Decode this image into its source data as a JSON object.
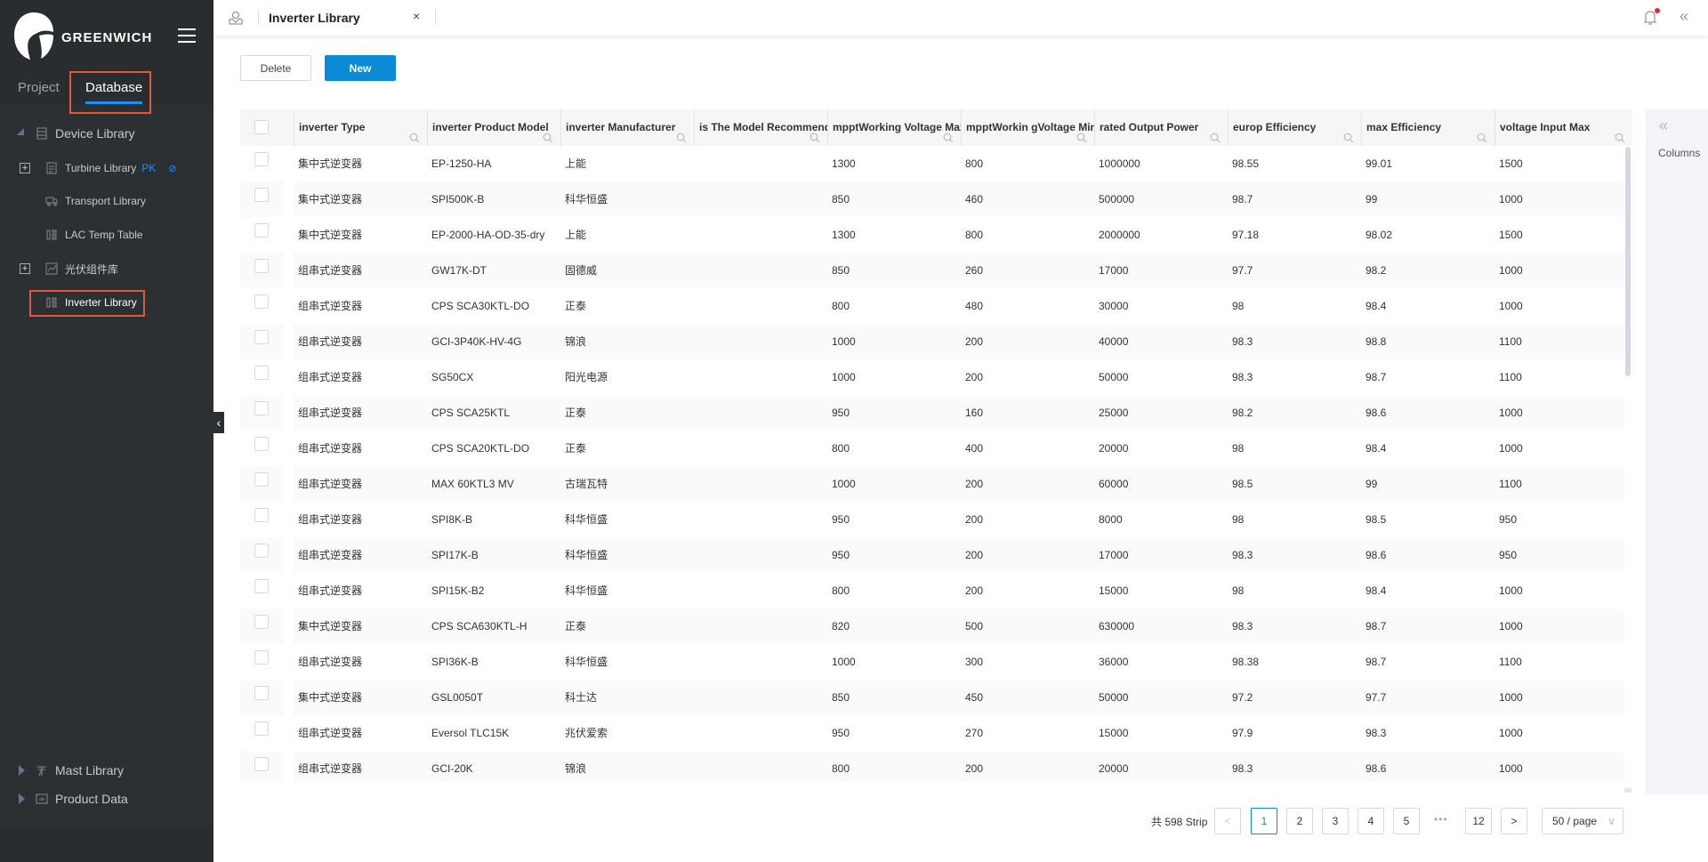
{
  "sidebar": {
    "brand": "GREENWICH",
    "tabs": [
      {
        "label": "Project"
      },
      {
        "label": "Database"
      }
    ],
    "active_tab": "Database",
    "tree": {
      "device_library": "Device Library",
      "turbine_library": "Turbine Library",
      "turbine_badge": "PK",
      "transport_library": "Transport Library",
      "lac_temp_table": "LAC Temp Table",
      "pv_module_library": "光伏组件库",
      "inverter_library": "Inverter Library",
      "mast_library": "Mast Library",
      "product_data": "Product Data"
    }
  },
  "tabbar": {
    "active_tab": "Inverter Library",
    "close": "×"
  },
  "toolbar": {
    "delete_label": "Delete",
    "new_label": "New"
  },
  "table": {
    "columns": [
      "inverter Type",
      "inverter Product Model",
      "inverter Manufacturer",
      "is The Model Recommended",
      "mpptWorking Voltage Max",
      "mpptWorkin gVoltage Min",
      "rated Output Power",
      "europ Efficiency",
      "max Efficiency",
      "voltage Input Max"
    ],
    "rows": [
      [
        "集中式逆变器",
        "EP-1250-HA",
        "上能",
        "",
        "1300",
        "800",
        "1000000",
        "98.55",
        "99.01",
        "1500"
      ],
      [
        "集中式逆变器",
        "SPI500K-B",
        "科华恒盛",
        "",
        "850",
        "460",
        "500000",
        "98.7",
        "99",
        "1000"
      ],
      [
        "集中式逆变器",
        "EP-2000-HA-OD-35-dry",
        "上能",
        "",
        "1300",
        "800",
        "2000000",
        "97.18",
        "98.02",
        "1500"
      ],
      [
        "组串式逆变器",
        "GW17K-DT",
        "固德威",
        "",
        "850",
        "260",
        "17000",
        "97.7",
        "98.2",
        "1000"
      ],
      [
        "组串式逆变器",
        "CPS SCA30KTL-DO",
        "正泰",
        "",
        "800",
        "480",
        "30000",
        "98",
        "98.4",
        "1000"
      ],
      [
        "组串式逆变器",
        "GCI-3P40K-HV-4G",
        "锦浪",
        "",
        "1000",
        "200",
        "40000",
        "98.3",
        "98.8",
        "1100"
      ],
      [
        "组串式逆变器",
        "SG50CX",
        "阳光电源",
        "",
        "1000",
        "200",
        "50000",
        "98.3",
        "98.7",
        "1100"
      ],
      [
        "组串式逆变器",
        "CPS SCA25KTL",
        "正泰",
        "",
        "950",
        "160",
        "25000",
        "98.2",
        "98.6",
        "1000"
      ],
      [
        "组串式逆变器",
        "CPS SCA20KTL-DO",
        "正泰",
        "",
        "800",
        "400",
        "20000",
        "98",
        "98.4",
        "1000"
      ],
      [
        "组串式逆变器",
        "MAX 60KTL3 MV",
        "古瑞瓦特",
        "",
        "1000",
        "200",
        "60000",
        "98.5",
        "99",
        "1100"
      ],
      [
        "组串式逆变器",
        "SPI8K-B",
        "科华恒盛",
        "",
        "950",
        "200",
        "8000",
        "98",
        "98.5",
        "950"
      ],
      [
        "组串式逆变器",
        "SPI17K-B",
        "科华恒盛",
        "",
        "950",
        "200",
        "17000",
        "98.3",
        "98.6",
        "950"
      ],
      [
        "组串式逆变器",
        "SPI15K-B2",
        "科华恒盛",
        "",
        "800",
        "200",
        "15000",
        "98",
        "98.4",
        "1000"
      ],
      [
        "集中式逆变器",
        "CPS SCA630KTL-H",
        "正泰",
        "",
        "820",
        "500",
        "630000",
        "98.3",
        "98.7",
        "1000"
      ],
      [
        "组串式逆变器",
        "SPI36K-B",
        "科华恒盛",
        "",
        "1000",
        "300",
        "36000",
        "98.38",
        "98.7",
        "1100"
      ],
      [
        "集中式逆变器",
        "GSL0050T",
        "科士达",
        "",
        "850",
        "450",
        "50000",
        "97.2",
        "97.7",
        "1000"
      ],
      [
        "组串式逆变器",
        "Eversol TLC15K",
        "兆伏爱索",
        "",
        "950",
        "270",
        "15000",
        "97.9",
        "98.3",
        "1000"
      ],
      [
        "组串式逆变器",
        "GCI-20K",
        "锦浪",
        "",
        "800",
        "200",
        "20000",
        "98.3",
        "98.6",
        "1000"
      ]
    ]
  },
  "right_panel": {
    "columns_label": "Columns"
  },
  "pagination": {
    "total_text": "共 598 Strip",
    "pages": [
      "1",
      "2",
      "3",
      "4",
      "5"
    ],
    "ellipsis": "•••",
    "last_page": "12",
    "current_page": "1",
    "page_size": "50 / page",
    "prev": "<",
    "next": ">"
  },
  "colors": {
    "accent": "#0b8ad6",
    "highlight_box": "#e05a3a",
    "sidebar_bg": "#2d3033",
    "notification_dot": "#f5222d"
  }
}
